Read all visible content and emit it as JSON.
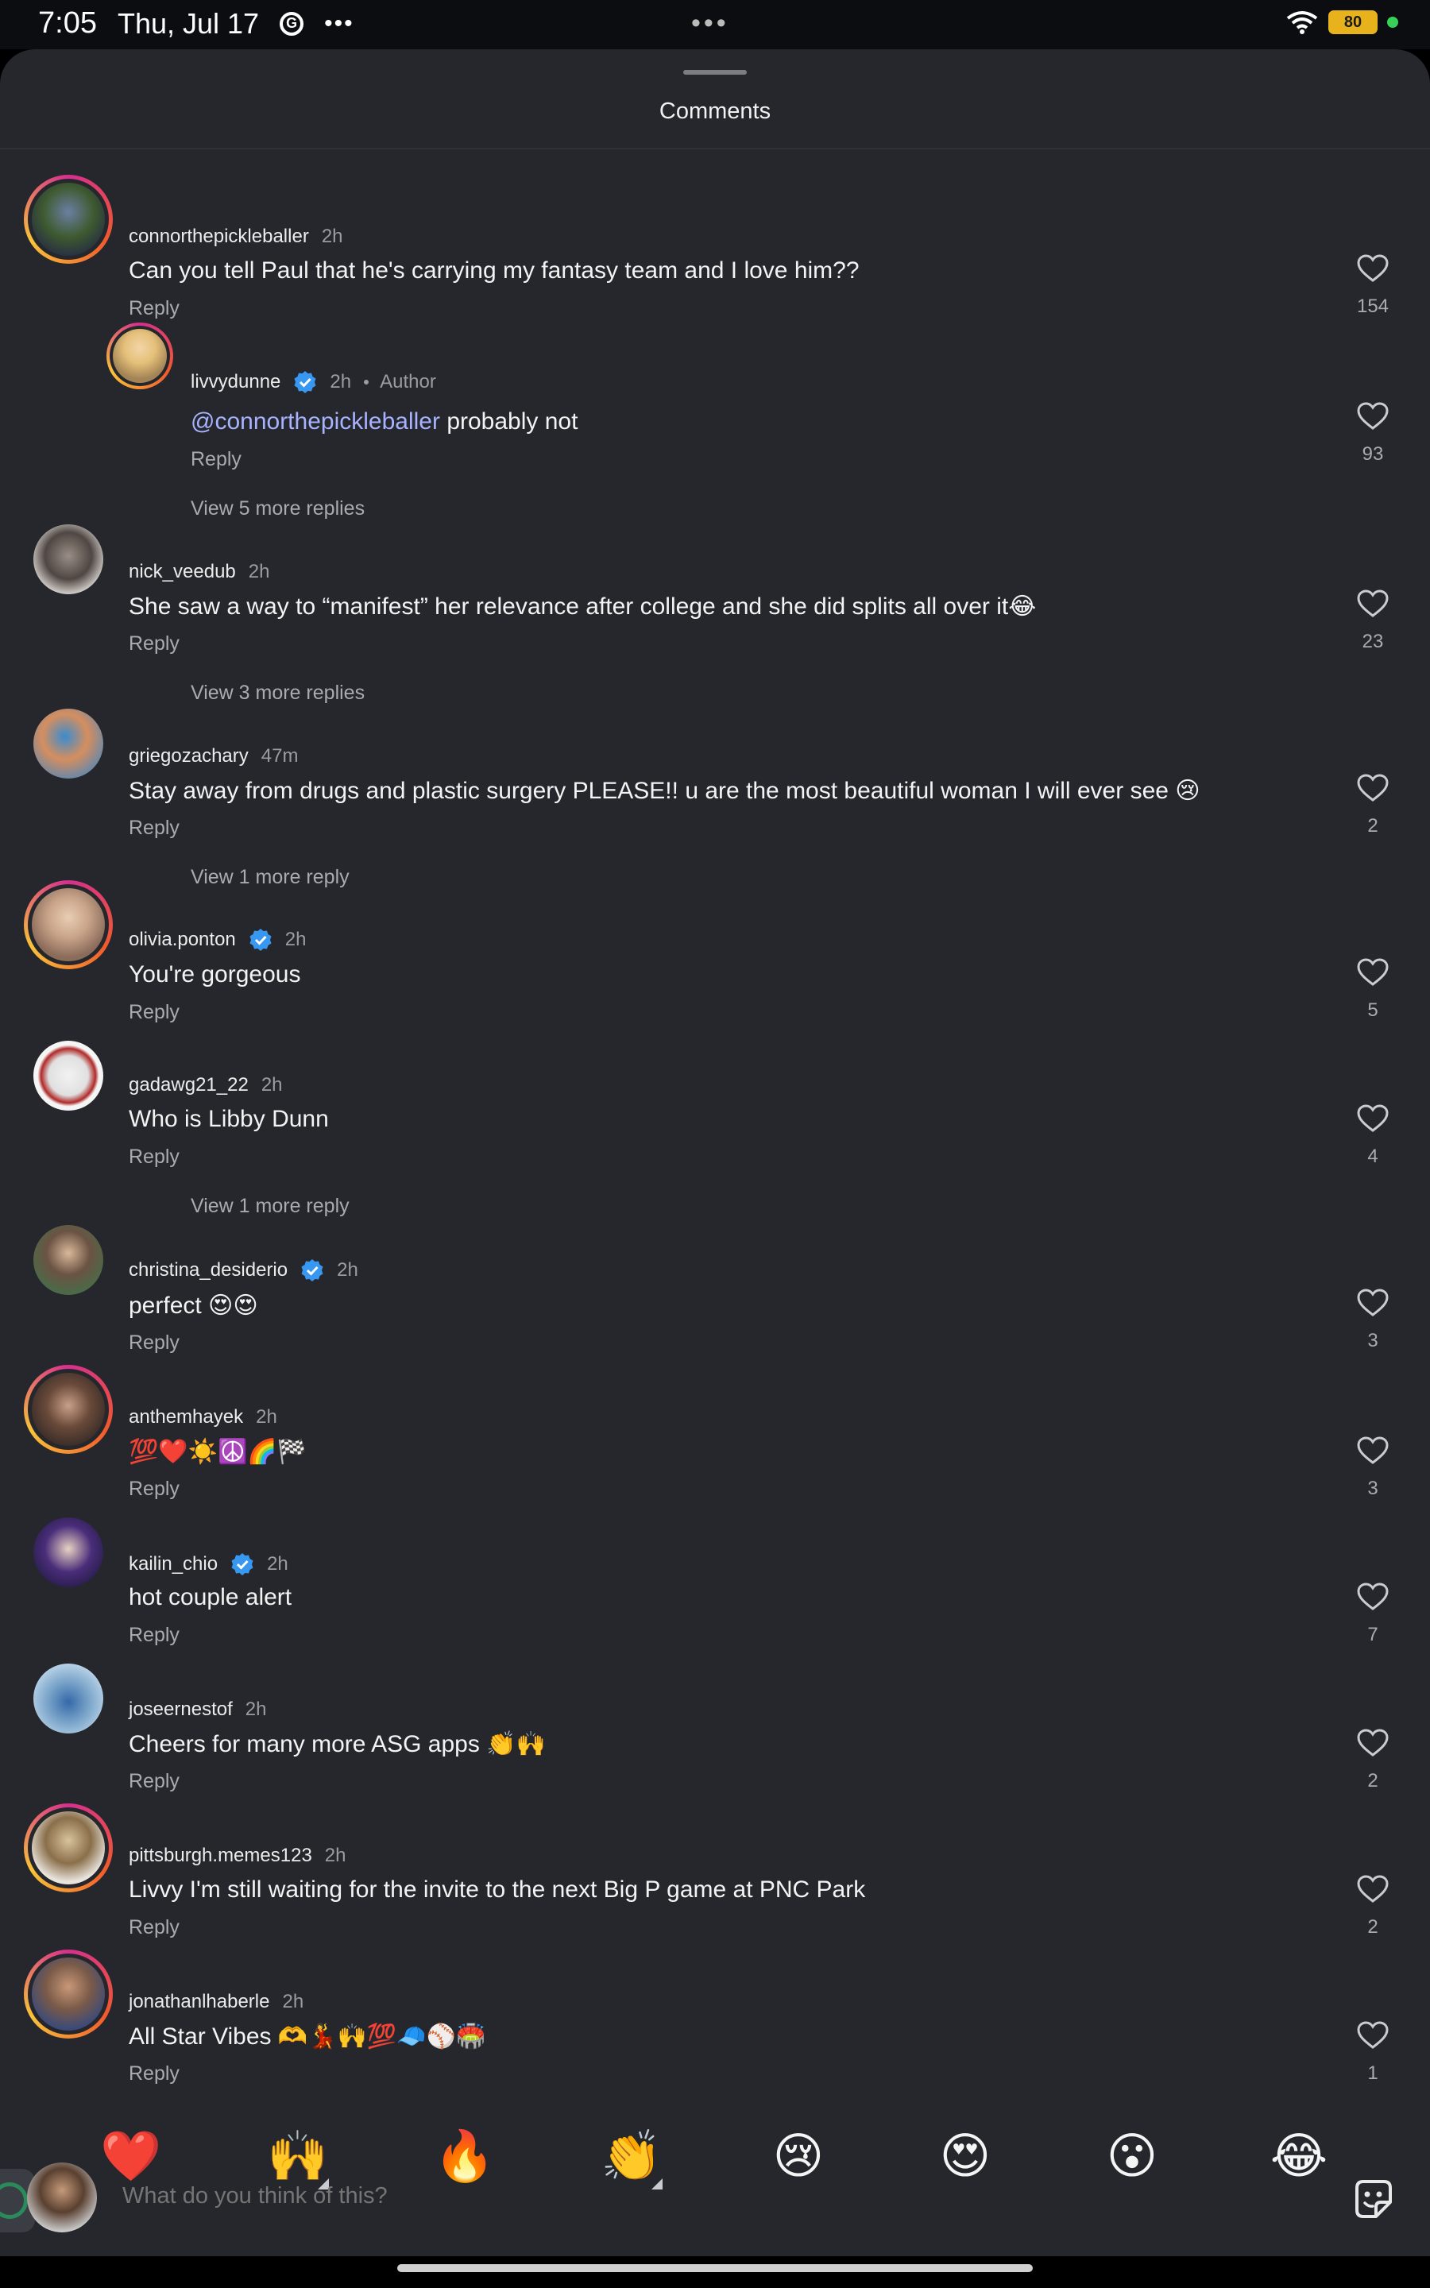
{
  "status_bar": {
    "time": "7:05",
    "date": "Thu, Jul 17",
    "battery": "80",
    "center_dots": "•••"
  },
  "sheet": {
    "title": "Comments"
  },
  "comments": [
    {
      "username": "connorthepickleballer",
      "time": "2h",
      "text": "Can you tell Paul that he's carrying my fantasy team and I love him??",
      "reply": "Reply",
      "likes": "154"
    },
    {
      "username": "livvydunne",
      "time": "2h",
      "author": "Author",
      "mention": "@connorthepickleballer",
      "text": "probably not",
      "reply": "Reply",
      "likes": "93",
      "view_more": "View 5 more replies"
    },
    {
      "username": "nick_veedub",
      "time": "2h",
      "text": "She saw a way to “manifest” her relevance after college and she did splits all over it😂",
      "reply": "Reply",
      "likes": "23",
      "view_more": "View 3 more replies"
    },
    {
      "username": "griegozachary",
      "time": "47m",
      "text": "Stay away from drugs and plastic surgery PLEASE!! u are the most beautiful woman I will ever see 😢",
      "reply": "Reply",
      "likes": "2",
      "view_more": "View 1 more reply"
    },
    {
      "username": "olivia.ponton",
      "time": "2h",
      "text": "You're gorgeous",
      "reply": "Reply",
      "likes": "5"
    },
    {
      "username": "gadawg21_22",
      "time": "2h",
      "text": "Who is Libby Dunn",
      "reply": "Reply",
      "likes": "4",
      "view_more": "View 1 more reply"
    },
    {
      "username": "christina_desiderio",
      "time": "2h",
      "text": "perfect 😍😍",
      "reply": "Reply",
      "likes": "3"
    },
    {
      "username": "anthemhayek",
      "time": "2h",
      "text": "💯❤️☀️☮️🌈🏁",
      "reply": "Reply",
      "likes": "3"
    },
    {
      "username": "kailin_chio",
      "time": "2h",
      "text": "hot couple alert",
      "reply": "Reply",
      "likes": "7"
    },
    {
      "username": "joseernestof",
      "time": "2h",
      "text": "Cheers for many more ASG apps 👏🙌",
      "reply": "Reply",
      "likes": "2"
    },
    {
      "username": "pittsburgh.memes123",
      "time": "2h",
      "text": "Livvy I'm still waiting for the invite to the next Big P game at PNC Park",
      "reply": "Reply",
      "likes": "2"
    },
    {
      "username": "jonathanlhaberle",
      "time": "2h",
      "text": "All Star Vibes 🫶💃🙌💯🧢⚾🏟️",
      "reply": "Reply",
      "likes": "1"
    }
  ],
  "reactions": [
    "❤️",
    "🙌",
    "🔥",
    "👏",
    "😢",
    "😍",
    "😮",
    "😂"
  ],
  "composer": {
    "placeholder": "What do you think of this?"
  },
  "icons": {
    "like": "heart-outline-icon",
    "verified": "verified-badge-icon",
    "sticker": "sticker-icon"
  },
  "colors": {
    "background": "#25272c",
    "verified": "#3897f0",
    "mention": "#a8b3ff",
    "story_ring": "#d62f8e"
  }
}
